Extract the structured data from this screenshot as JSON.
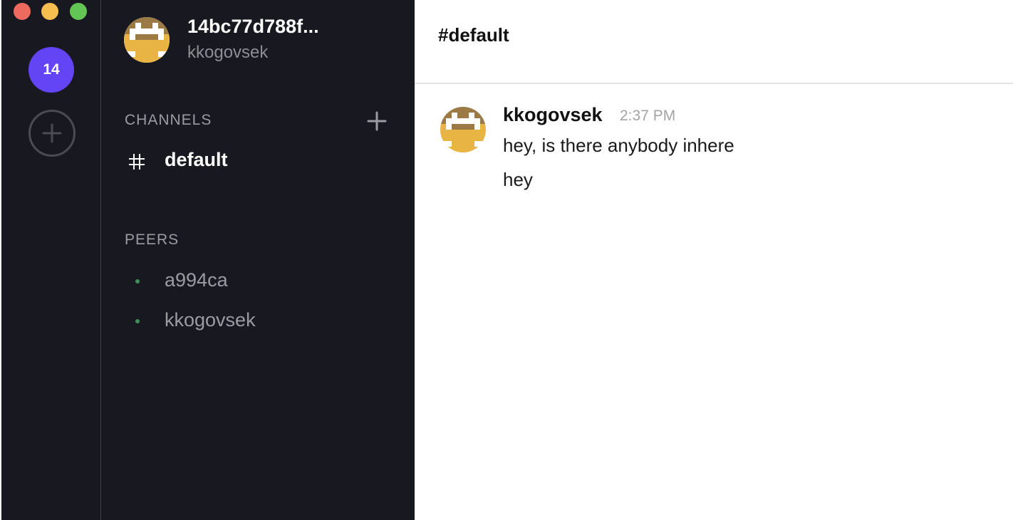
{
  "window": {
    "controls": [
      "close",
      "minimize",
      "zoom"
    ]
  },
  "workspaces": {
    "current_badge": "14",
    "badge_color": "#6345f5",
    "add_icon": "plus-circle-icon"
  },
  "profile": {
    "name": "14bc77d788f...",
    "username": "kkogovsek",
    "avatar_icon": "pixel-avatar-icon"
  },
  "channels": {
    "header": "CHANNELS",
    "add_icon": "plus-icon",
    "items": [
      {
        "icon": "hash-icon",
        "label": "default",
        "active": true
      }
    ]
  },
  "peers": {
    "header": "PEERS",
    "status_color": "#3f8f5c",
    "items": [
      {
        "label": "a994ca"
      },
      {
        "label": "kkogovsek"
      }
    ]
  },
  "main": {
    "channel_title": "#default",
    "messages": [
      {
        "author": "kkogovsek",
        "time": "2:37 PM",
        "lines": [
          "hey, is there anybody inhere",
          "hey"
        ]
      }
    ]
  },
  "colors": {
    "sidebar_bg": "#181920",
    "avatar_brown": "#9c7a45",
    "avatar_yellow": "#e8b444",
    "close": "#ee6a5f",
    "minimize": "#f5be4f",
    "zoom": "#62c554"
  }
}
